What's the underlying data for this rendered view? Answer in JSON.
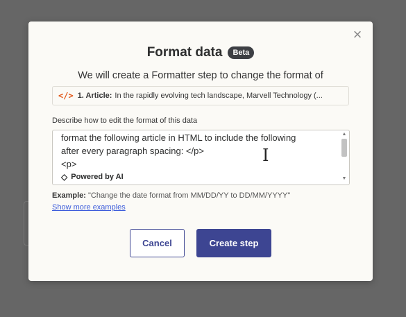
{
  "modal": {
    "title": "Format data",
    "badge": "Beta",
    "subtitle": "We will create a Formatter step to change the format of",
    "close_icon": "×",
    "field": {
      "icon": "</>",
      "name": "1. Article:",
      "value": "In the rapidly evolving tech landscape, Marvell Technology (..."
    },
    "description_label": "Describe how to edit the format of this data",
    "editor": {
      "line1": "format the following article in HTML to include the following",
      "line2": "after every paragraph spacing: </p>",
      "line3": "<p>"
    },
    "powered_by": "Powered by AI",
    "example_label": "Example:",
    "example_text": "\"Change the date format from MM/DD/YY to DD/MM/YYYY\"",
    "show_more": "Show more examples",
    "cancel_label": "Cancel",
    "create_label": "Create step"
  }
}
